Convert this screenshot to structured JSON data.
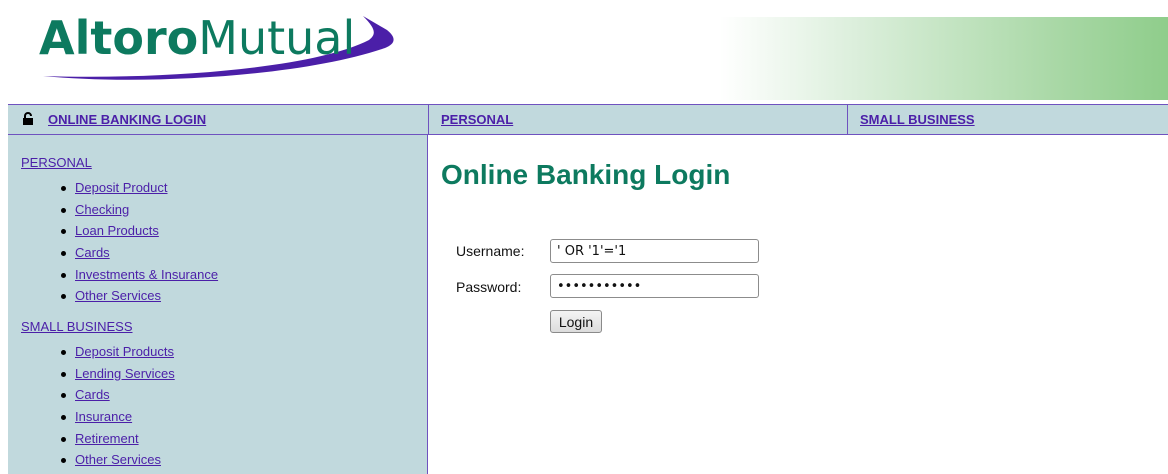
{
  "header": {
    "logo": {
      "part1": "Altoro",
      "part2": "Mutual",
      "alt": "AltoroMutual"
    }
  },
  "topnav": {
    "login_link": "ONLINE BANKING LOGIN",
    "personal": "PERSONAL",
    "small_business": "SMALL BUSINESS"
  },
  "sidebar": {
    "personal_heading": "PERSONAL",
    "personal_items": [
      "Deposit Product",
      "Checking",
      "Loan Products",
      "Cards",
      "Investments & Insurance",
      "Other Services"
    ],
    "business_heading": "SMALL BUSINESS",
    "business_items": [
      "Deposit Products",
      "Lending Services",
      "Cards",
      "Insurance",
      "Retirement",
      "Other Services"
    ]
  },
  "main": {
    "title": "Online Banking Login",
    "username_label": "Username:",
    "username_value": "' OR '1'='1",
    "password_label": "Password:",
    "password_value": "xxxxxxxxxxx",
    "login_button": "Login"
  },
  "colors": {
    "brand_green": "#0d7a5f",
    "brand_purple": "#4b1fa8",
    "nav_bg": "#c1d9dd",
    "border": "#6f52bf"
  },
  "icons": {
    "login": "lock-icon"
  }
}
